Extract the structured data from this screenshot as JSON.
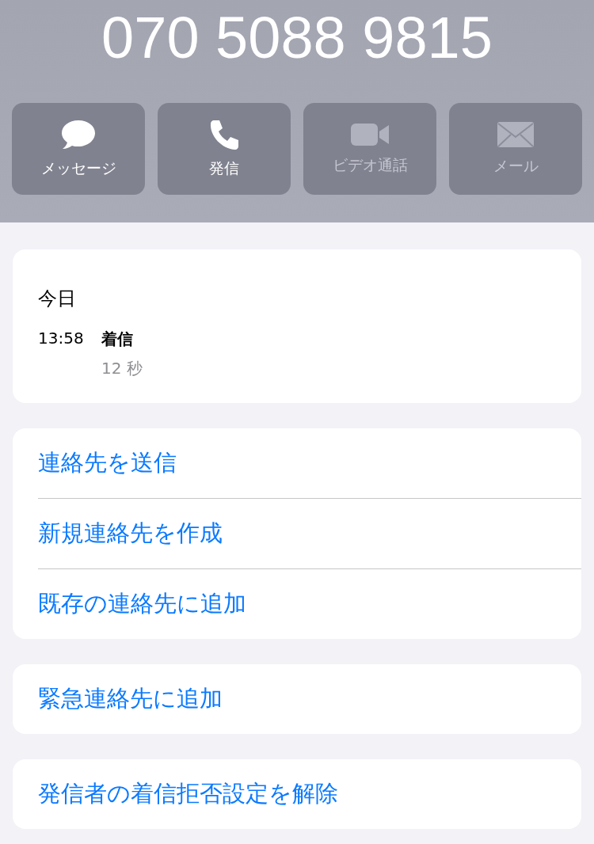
{
  "header": {
    "phone_number": "070 5088 9815"
  },
  "actions": [
    {
      "kind": "message",
      "label": "メッセージ",
      "disabled": false
    },
    {
      "kind": "call",
      "label": "発信",
      "disabled": false
    },
    {
      "kind": "video",
      "label": "ビデオ通話",
      "disabled": true
    },
    {
      "kind": "mail",
      "label": "メール",
      "disabled": true
    }
  ],
  "call_log": {
    "date": "今日",
    "entries": [
      {
        "time": "13:58",
        "type": "着信",
        "duration": "12 秒"
      }
    ]
  },
  "action_groups": [
    [
      "連絡先を送信",
      "新規連絡先を作成",
      "既存の連絡先に追加"
    ],
    [
      "緊急連絡先に追加"
    ],
    [
      "発信者の着信拒否設定を解除"
    ]
  ]
}
